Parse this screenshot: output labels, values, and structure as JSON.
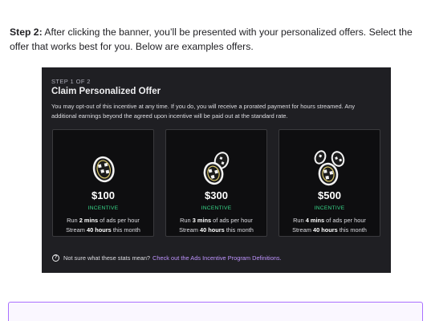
{
  "intro": {
    "step_label": "Step 2:",
    "text": " After clicking the banner, you’ll be presented with your personalized offers. Select the offer that works best for you. Below are examples offers."
  },
  "dialog": {
    "step_counter": "STEP 1 OF 2",
    "title": "Claim Personalized Offer",
    "description": "You may opt-out of this incentive at any time. If you do, you will receive a prorated payment for hours streamed. Any additional earnings beyond the agreed upon incentive will be paid out at the standard rate.",
    "offers": [
      {
        "amount": "$100",
        "badge": "INCENTIVE",
        "line1_pre": "Run ",
        "line1_bold": "2 mins",
        "line1_post": " of ads per hour",
        "line2_pre": "Stream ",
        "line2_bold": "40 hours",
        "line2_post": " this month",
        "icon": "single-coin-icon"
      },
      {
        "amount": "$300",
        "badge": "INCENTIVE",
        "line1_pre": "Run ",
        "line1_bold": "3 mins",
        "line1_post": " of ads per hour",
        "line2_pre": "Stream ",
        "line2_bold": "40 hours",
        "line2_post": " this month",
        "icon": "double-coin-icon"
      },
      {
        "amount": "$500",
        "badge": "INCENTIVE",
        "line1_pre": "Run ",
        "line1_bold": "4 mins",
        "line1_post": " of ads per hour",
        "line2_pre": "Stream ",
        "line2_bold": "40 hours",
        "line2_post": " this month",
        "icon": "triple-coin-icon"
      }
    ],
    "help_text": "Not sure what these stats mean?",
    "help_link": "Check out the Ads Incentive Program Definitions."
  },
  "colors": {
    "dialog_bg": "#1f1f23",
    "card_bg": "#0e0e10",
    "incentive_green": "#38d98a",
    "link_purple": "#bf94ff",
    "box_border": "#a970ff"
  }
}
